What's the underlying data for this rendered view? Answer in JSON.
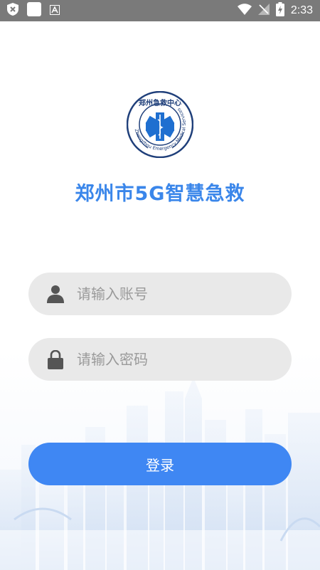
{
  "status_bar": {
    "time": "2:33",
    "left_icons": [
      "shield-x-icon",
      "white-square-icon",
      "font-a-icon"
    ],
    "right_icons": [
      "wifi-icon",
      "no-signal-icon",
      "battery-charging-icon"
    ]
  },
  "app": {
    "logo": {
      "text_top": "郑州急救中心",
      "text_ring": "Zhengzhou Emergency Medical Services"
    },
    "title": "郑州市5G智慧急救",
    "account": {
      "placeholder": "请输入账号",
      "value": "",
      "icon": "user-icon"
    },
    "password": {
      "placeholder": "请输入密码",
      "value": "",
      "icon": "lock-icon"
    },
    "login_label": "登录"
  },
  "colors": {
    "accent": "#3f87f3",
    "title": "#3a86ea",
    "field_bg": "#e9e9e9",
    "status_bar": "#7a7a7a"
  }
}
